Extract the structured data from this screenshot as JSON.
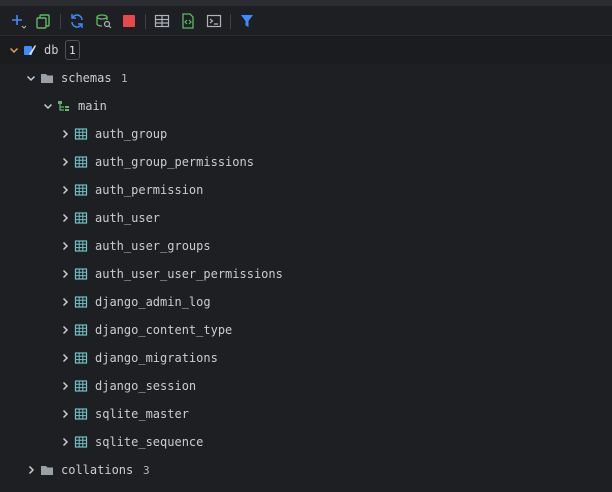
{
  "toolbar": {
    "buttons": [
      {
        "name": "add-icon"
      },
      {
        "name": "copy-icon"
      },
      {
        "name": "refresh-icon"
      },
      {
        "name": "schema-search-icon"
      },
      {
        "name": "stop-icon"
      },
      {
        "name": "table-view-icon"
      },
      {
        "name": "ddl-script-icon"
      },
      {
        "name": "console-icon"
      },
      {
        "name": "filter-icon"
      }
    ],
    "colors": {
      "accent_blue": "#3d8bfd",
      "green": "#5fb865",
      "red": "#e5484d",
      "gray": "#aeb3ba"
    }
  },
  "tree": {
    "db": {
      "label": "db",
      "badge": "1"
    },
    "schemas": {
      "label": "schemas",
      "count": "1"
    },
    "main": {
      "label": "main"
    },
    "tables": [
      {
        "label": "auth_group"
      },
      {
        "label": "auth_group_permissions"
      },
      {
        "label": "auth_permission"
      },
      {
        "label": "auth_user"
      },
      {
        "label": "auth_user_groups"
      },
      {
        "label": "auth_user_user_permissions"
      },
      {
        "label": "django_admin_log"
      },
      {
        "label": "django_content_type"
      },
      {
        "label": "django_migrations"
      },
      {
        "label": "django_session"
      },
      {
        "label": "sqlite_master"
      },
      {
        "label": "sqlite_sequence"
      }
    ],
    "collations": {
      "label": "collations",
      "count": "3"
    }
  }
}
